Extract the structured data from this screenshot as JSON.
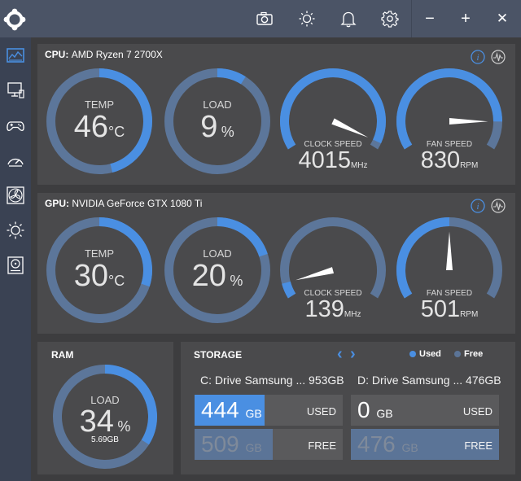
{
  "colors": {
    "accent": "#4a8fe2",
    "track": "#5c769a",
    "panel": "#4a4a4c",
    "titlebar": "#4b5466",
    "used_bar": "#4a8fe2",
    "free_bar": "#5b7497"
  },
  "titlebar": {
    "icons": [
      "camera-icon",
      "brightness-icon",
      "bell-icon",
      "gear-icon"
    ],
    "minimize": "−",
    "maximize": "+",
    "close": "✕"
  },
  "sidebar": {
    "items": [
      "dashboard-icon",
      "monitor-icon",
      "gamepad-icon",
      "speedometer-icon",
      "fan-icon",
      "lighting-icon",
      "storage-icon"
    ]
  },
  "cpu": {
    "label": "CPU:",
    "name": "AMD Ryzen 7 2700X",
    "temp": {
      "label": "TEMP",
      "value": "46",
      "unit": "°C",
      "fraction": 0.46
    },
    "load": {
      "label": "LOAD",
      "value": "9",
      "unit": "%",
      "fraction": 0.09
    },
    "clock": {
      "label": "CLOCK SPEED",
      "value": "4015",
      "unit": "MHz",
      "fraction": 0.97
    },
    "fan": {
      "label": "FAN SPEED",
      "value": "830",
      "unit": "RPM",
      "fraction": 0.87
    }
  },
  "gpu": {
    "label": "GPU:",
    "name": "NVIDIA GeForce GTX 1080 Ti",
    "temp": {
      "label": "TEMP",
      "value": "30",
      "unit": "°C",
      "fraction": 0.3
    },
    "load": {
      "label": "LOAD",
      "value": "20",
      "unit": "%",
      "fraction": 0.2
    },
    "clock": {
      "label": "CLOCK SPEED",
      "value": "139",
      "unit": "MHz",
      "fraction": 0.07
    },
    "fan": {
      "label": "FAN SPEED",
      "value": "501",
      "unit": "RPM",
      "fraction": 0.5
    }
  },
  "ram": {
    "title": "RAM",
    "label": "LOAD",
    "value": "34",
    "unit": "%",
    "sub": "5.69GB",
    "fraction": 0.34
  },
  "storage": {
    "title": "STORAGE",
    "prev": "‹",
    "next": "›",
    "legend_used": "Used",
    "legend_free": "Free",
    "drives": [
      {
        "name": "C: Drive Samsung ... 953GB",
        "used": "444",
        "free": "509",
        "unit": "GB",
        "used_tag": "USED",
        "free_tag": "FREE",
        "used_fraction": 0.47,
        "free_fraction": 0.53
      },
      {
        "name": "D: Drive Samsung ... 476GB",
        "used": "0",
        "free": "476",
        "unit": "GB",
        "used_tag": "USED",
        "free_tag": "FREE",
        "used_fraction": 0.0,
        "free_fraction": 1.0
      }
    ]
  }
}
